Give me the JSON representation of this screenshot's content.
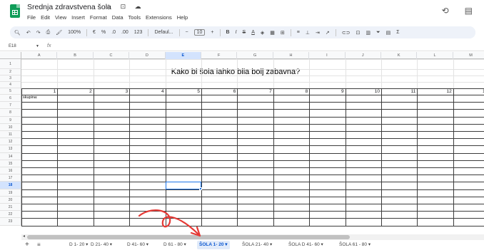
{
  "app": {
    "title": "Srednja zdravstvena šola",
    "title_icons": "☆ ⊡ ☁"
  },
  "menu": [
    "File",
    "Edit",
    "View",
    "Insert",
    "Format",
    "Data",
    "Tools",
    "Extensions",
    "Help"
  ],
  "toolbar": {
    "zoom": "100%",
    "currency": "€",
    "percent": "%",
    "dec_less": ".0",
    ".dec_more": ".00",
    "format_123": "123",
    "font": "Defaul...",
    "font_size": "10",
    "minus": "−",
    "plus": "+",
    "bold": "B",
    "italic": "I",
    "strike": "S",
    "text_color": "A",
    "sigma": "Σ"
  },
  "formula_bar": {
    "cell_ref": "E18",
    "fx": "fx"
  },
  "grid": {
    "columns": [
      "A",
      "B",
      "C",
      "D",
      "E",
      "F",
      "G",
      "H",
      "I",
      "J",
      "K",
      "L",
      "M"
    ],
    "selected_column": "E",
    "rows": [
      "1",
      "2",
      "3",
      "4",
      "5",
      "6",
      "7",
      "8",
      "9",
      "10",
      "11",
      "12",
      "13",
      "14",
      "15",
      "16",
      "17",
      "18",
      "19",
      "20",
      "21",
      "22",
      "23"
    ],
    "selected_row": "18",
    "title": "Kako bi šola lahko bila bolj zabavna?",
    "row4_label": "skupina:",
    "row5_numbers": [
      "1",
      "2",
      "3",
      "4",
      "5",
      "6",
      "7",
      "8",
      "9",
      "10",
      "11",
      "12",
      "13"
    ]
  },
  "tabs": {
    "add": "+",
    "list": "≡",
    "items": [
      {
        "label": "D 1- 20",
        "active": false
      },
      {
        "label": "D 21- 40",
        "active": false
      },
      {
        "label": "D 41- 60",
        "active": false
      },
      {
        "label": "D 61 - 80",
        "active": false
      },
      {
        "label": "ŠOLA 1- 20",
        "active": true
      },
      {
        "label": "ŠOLA 21- 40",
        "active": false
      },
      {
        "label": "ŠOLA D 41- 60",
        "active": false
      },
      {
        "label": "ŠOLA 61 - 80",
        "active": false
      }
    ]
  },
  "colors": {
    "accent": "#1a73e8",
    "arrow": "#e53935",
    "sheets_green": "#0f9d58"
  }
}
